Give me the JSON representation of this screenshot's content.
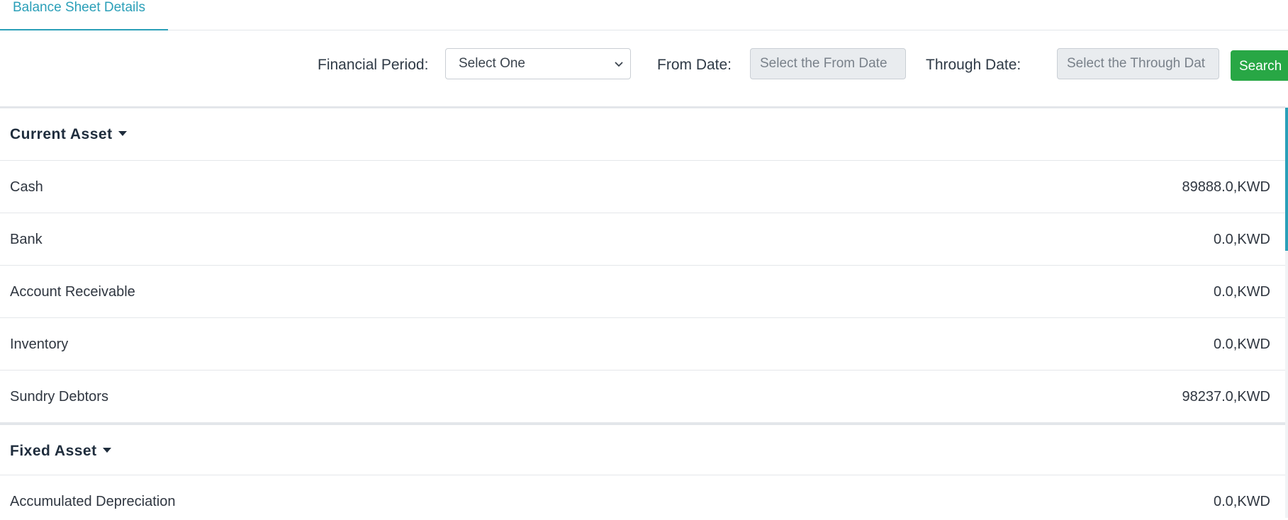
{
  "tabs": [
    {
      "label": "Balance Sheet Details",
      "active": true
    }
  ],
  "filters": {
    "financial_period_label": "Financial Period:",
    "financial_period_value": "Select One",
    "from_date_label": "From Date:",
    "from_date_placeholder": "Select the From Date",
    "through_date_label": "Through Date:",
    "through_date_placeholder": "Select the Through Dat",
    "search_label": "Search"
  },
  "groups": [
    {
      "title": "Current Asset",
      "rows": [
        {
          "name": "Cash",
          "value": "89888.0,KWD"
        },
        {
          "name": "Bank",
          "value": "0.0,KWD"
        },
        {
          "name": "Account Receivable",
          "value": "0.0,KWD"
        },
        {
          "name": "Inventory",
          "value": "0.0,KWD"
        },
        {
          "name": "Sundry Debtors",
          "value": "98237.0,KWD"
        }
      ]
    },
    {
      "title": "Fixed Asset",
      "rows": [
        {
          "name": "Accumulated Depreciation",
          "value": "0.0,KWD"
        }
      ]
    }
  ],
  "colors": {
    "accent": "#2a9fb8",
    "search_button": "#28a745"
  },
  "icons": {
    "select": "chevron-down-icon",
    "group_toggle": "caret-down-icon"
  }
}
